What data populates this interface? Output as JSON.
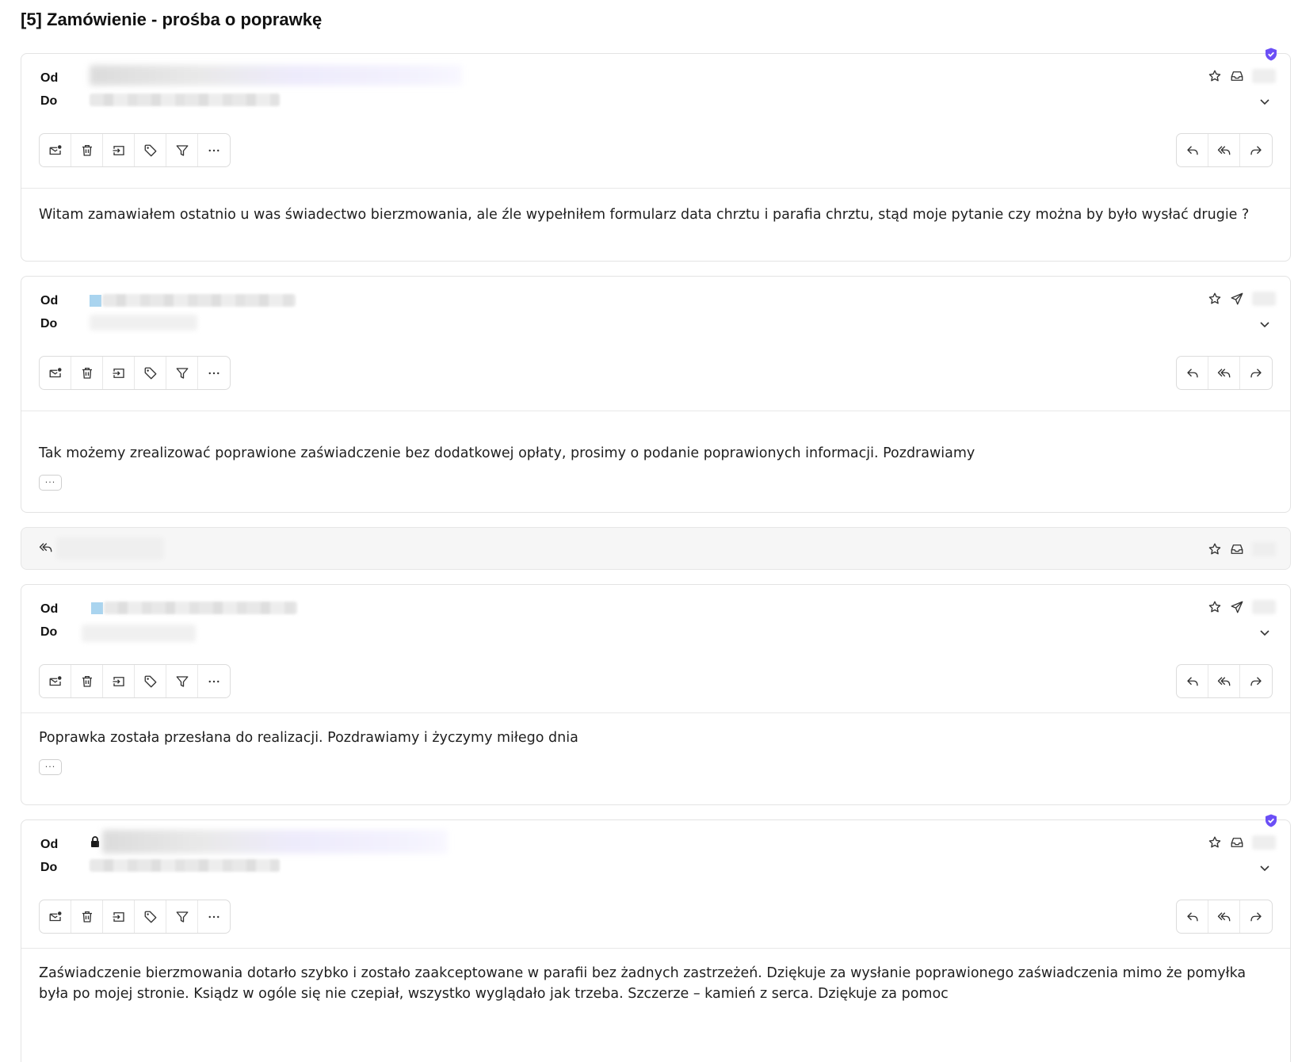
{
  "thread": {
    "title": "[5] Zamówienie - prośba o poprawkę"
  },
  "labels": {
    "from": "Od",
    "to": "Do"
  },
  "icons": {
    "star": "star-icon",
    "inbox": "inbox-icon",
    "sent": "send-icon",
    "chevron": "chevron-down-icon",
    "shield": "verified-shield-icon",
    "lock": "lock-icon",
    "toolbar": [
      "mark-unread-icon",
      "trash-icon",
      "move-icon",
      "tag-icon",
      "filter-icon",
      "more-icon"
    ],
    "actions": [
      "reply-icon",
      "reply-all-icon",
      "forward-icon"
    ]
  },
  "colors": {
    "accent": "#6b4ff6",
    "blurred_sender": "#a9d4ef"
  },
  "messages": [
    {
      "body": "Witam zamawiałem ostatnio u was świadectwo bierzmowania, ale źle wypełniłem formularz data chrztu i parafia chrztu, stąd moje pytanie czy można by było wysłać drugie ?"
    },
    {
      "body": "Tak możemy zrealizować poprawione zaświadczenie bez dodatkowej opłaty, prosimy o podanie poprawionych informacji. Pozdrawiamy",
      "more_label": "···"
    },
    {
      "body": "Poprawka została przesłana do realizacji. Pozdrawiamy i życzymy miłego dnia",
      "more_label": "···"
    },
    {
      "body": "Zaświadczenie bierzmowania dotarło szybko i zostało zaakceptowane w parafii bez żadnych zastrzeżeń. Dziękuje za wysłanie poprawionego zaświadczenia mimo że pomyłka była po mojej stronie. Ksiądz w ogóle się nie czepiał, wszystko wyglądało jak trzeba. Szczerze – kamień z serca. Dziękuje za pomoc"
    }
  ]
}
